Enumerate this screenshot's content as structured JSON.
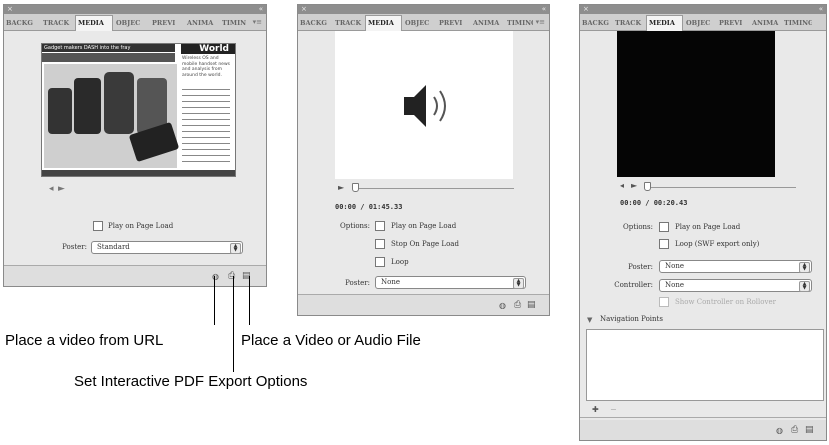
{
  "tabs": [
    "BACKG",
    "TRACK",
    "MEDIA",
    "OBJEC",
    "PREVI",
    "ANIMA",
    "TIMING"
  ],
  "panel1": {
    "preview": {
      "headline": "Gadget makers DASH into the fray",
      "world_label": "World",
      "sidebar_text": "Wireless OS and mobile handset news and analysis from around the world."
    },
    "play_on_load_label": "Play on Page Load",
    "poster_label": "Poster:",
    "poster_value": "Standard"
  },
  "panel2": {
    "timecode": "00:00 / 01:45.33",
    "options_label": "Options:",
    "play_on_load_label": "Play on Page Load",
    "stop_on_load_label": "Stop On Page Load",
    "loop_label": "Loop",
    "poster_label": "Poster:",
    "poster_value": "None"
  },
  "panel3": {
    "timecode": "00:00 / 00:20.43",
    "options_label": "Options:",
    "play_on_load_label": "Play on Page Load",
    "loop_label": "Loop (SWF export only)",
    "poster_label": "Poster:",
    "poster_value": "None",
    "controller_label": "Controller:",
    "controller_value": "None",
    "show_controller_label": "Show Controller on Rollover",
    "nav_points_label": "Navigation Points"
  },
  "callouts": {
    "url": "Place a video from URL",
    "file": "Place a Video or Audio File",
    "pdf": "Set Interactive PDF Export Options"
  },
  "icons": {
    "close": "×",
    "collapse": "«",
    "menu": "▾≡",
    "play": "►",
    "speaker": "speaker-icon",
    "film": "film-icon",
    "pdf": "pdf-options-icon",
    "globe": "url-icon"
  }
}
